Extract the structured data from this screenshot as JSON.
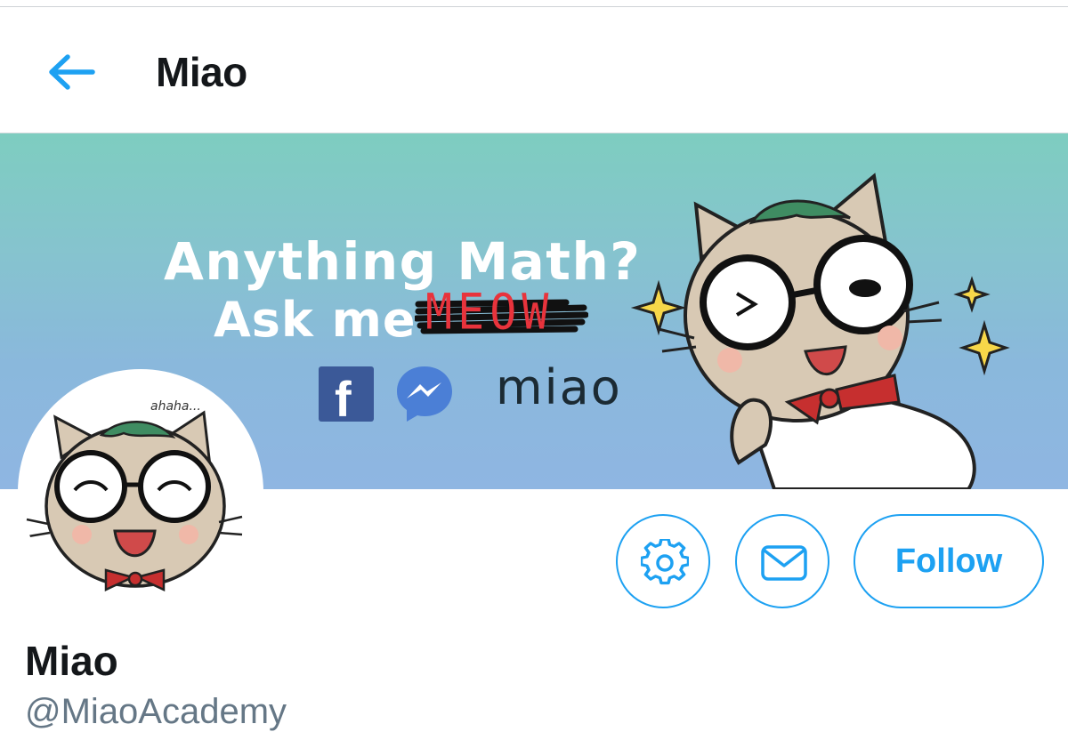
{
  "header": {
    "title": "Miao",
    "back_icon": "arrow-left-icon"
  },
  "banner": {
    "headline": "Anything Math?",
    "subline": "Ask me",
    "scribble_word": "MEOW",
    "facebook_letter": "f",
    "brand": "miao"
  },
  "profile": {
    "display_name": "Miao",
    "handle": "@MiaoAcademy"
  },
  "actions": {
    "settings_icon": "gear-icon",
    "message_icon": "envelope-icon",
    "follow_label": "Follow"
  },
  "colors": {
    "accent": "#1da1f2",
    "facebook": "#3b5998",
    "meow_red": "#e8333c"
  }
}
